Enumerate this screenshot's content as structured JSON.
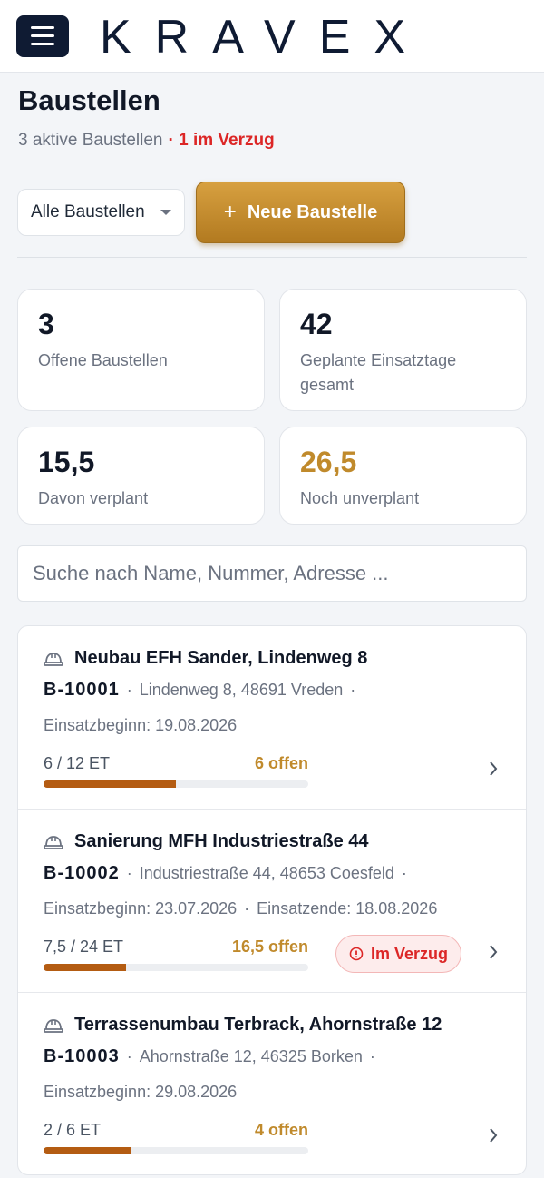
{
  "header": {
    "brand": "KRAVEX"
  },
  "page": {
    "title": "Baustellen",
    "subtitle": "3 aktive Baustellen",
    "overdue": "· 1 im Verzug"
  },
  "toolbar": {
    "filter_value": "Alle Baustellen",
    "new_button_label": "Neue Baustelle"
  },
  "stats": [
    {
      "value": "3",
      "label": "Offene Baustellen"
    },
    {
      "value": "42",
      "label": "Geplante Einsatztage gesamt"
    },
    {
      "value": "15,5",
      "label": "Davon verplant"
    },
    {
      "value": "26,5",
      "label": "Noch unverplant"
    }
  ],
  "search": {
    "placeholder": "Suche nach Name, Nummer, Adresse ..."
  },
  "sites": [
    {
      "title": "Neubau EFH Sander, Lindenweg 8",
      "number": "B-10001",
      "address": "Lindenweg 8, 48691 Vreden",
      "start": "Einsatzbeginn: 19.08.2026",
      "end": "",
      "et": "6 / 12 ET",
      "open": "6 offen",
      "progress": 0.5,
      "badge": ""
    },
    {
      "title": "Sanierung MFH Industriestraße 44",
      "number": "B-10002",
      "address": "Industriestraße 44, 48653 Coesfeld",
      "start": "Einsatzbeginn: 23.07.2026",
      "end": "Einsatzende: 18.08.2026",
      "et": "7,5 / 24 ET",
      "open": "16,5 offen",
      "progress": 0.3125,
      "badge": "Im Verzug"
    },
    {
      "title": "Terrassenumbau Terbrack, Ahornstraße 12",
      "number": "B-10003",
      "address": "Ahornstraße 12, 46325 Borken",
      "start": "Einsatzbeginn: 29.08.2026",
      "end": "",
      "et": "2 / 6 ET",
      "open": "4 offen",
      "progress": 0.3333,
      "badge": ""
    }
  ],
  "colors": {
    "accent": "#c08a2c",
    "navy": "#0f1b33",
    "logo_blue": "#2f6bff",
    "danger": "#dc2626",
    "bar": "#b45c12"
  }
}
